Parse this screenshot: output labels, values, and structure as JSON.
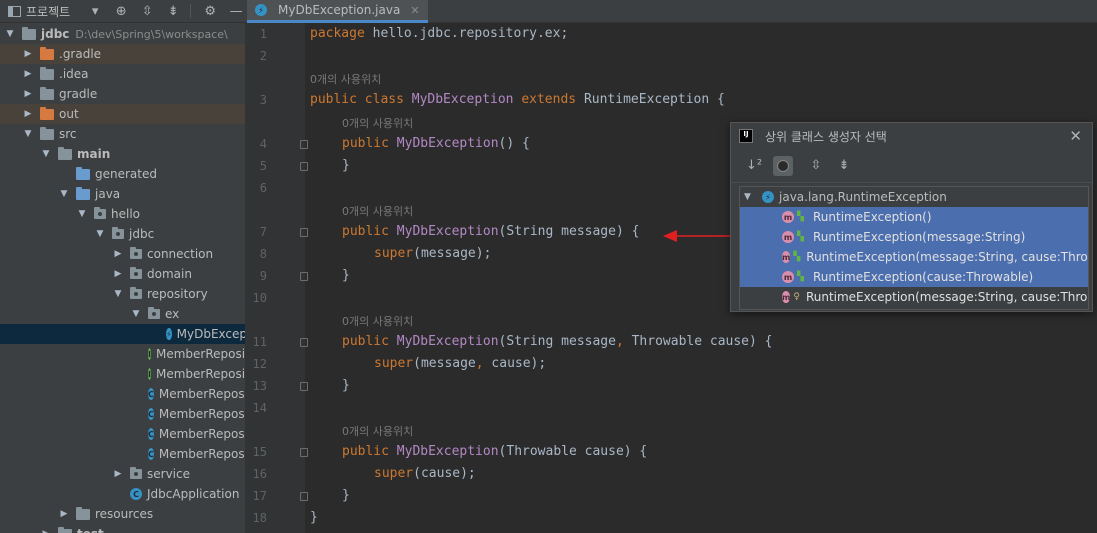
{
  "project_panel": {
    "title": "프로젝트",
    "toolbar_icons": [
      "chevron-down-icon",
      "target-icon",
      "expand-all-icon",
      "collapse-all-icon",
      "gear-icon",
      "minimize-icon"
    ],
    "tree": [
      {
        "label": "jdbc",
        "path": "D:\\dev\\Spring\\5\\workspace\\"
      },
      {
        "label": ".gradle"
      },
      {
        "label": ".idea"
      },
      {
        "label": "gradle"
      },
      {
        "label": "out"
      },
      {
        "label": "src"
      },
      {
        "label": "main"
      },
      {
        "label": "generated"
      },
      {
        "label": "java"
      },
      {
        "label": "hello"
      },
      {
        "label": "jdbc"
      },
      {
        "label": "connection"
      },
      {
        "label": "domain"
      },
      {
        "label": "repository"
      },
      {
        "label": "ex"
      },
      {
        "label": "MyDbExcep"
      },
      {
        "label": "MemberReposi"
      },
      {
        "label": "MemberReposi"
      },
      {
        "label": "MemberReposi"
      },
      {
        "label": "MemberReposi"
      },
      {
        "label": "MemberReposi"
      },
      {
        "label": "MemberReposi"
      },
      {
        "label": "service"
      },
      {
        "label": "JdbcApplication"
      },
      {
        "label": "resources"
      },
      {
        "label": "test"
      }
    ]
  },
  "editor": {
    "tab_label": "MyDbException.java",
    "usage_hint": "0개의 사용위치",
    "line_numbers": [
      "1",
      "2",
      "3",
      "4",
      "5",
      "6",
      "7",
      "8",
      "9",
      "10",
      "11",
      "12",
      "13",
      "14",
      "15",
      "16",
      "17",
      "18"
    ],
    "code": {
      "l1_kw": "package",
      "l1_rest": " hello.jdbc.repository.ex;",
      "l3_kw1": "public class",
      "l3_cls": " MyDbException ",
      "l3_kw2": "extends",
      "l3_rest": " RuntimeException {",
      "l4_kw": "public",
      "l4_fn": " MyDbException",
      "l4_rest": "() {",
      "close_brace": "}",
      "l7_kw": "public",
      "l7_fn": " MyDbException",
      "l7_rest": "(String message) {",
      "l8_kw": "super",
      "l8_rest": "(message);",
      "l11_kw": "public",
      "l11_fn": " MyDbException",
      "l11_a": "(String message",
      "l11_comma": ",",
      "l11_b": " Throwable cause) {",
      "l12_kw": "super",
      "l12_a": "(message",
      "l12_comma": ",",
      "l12_b": " cause);",
      "l15_kw": "public",
      "l15_fn": " MyDbException",
      "l15_rest": "(Throwable cause) {",
      "l16_kw": "super",
      "l16_rest": "(cause);"
    }
  },
  "popup": {
    "title": "상위 클래스 생성자 선택",
    "root": "java.lang.RuntimeException",
    "items": [
      {
        "label": "RuntimeException()",
        "selected": true,
        "access": "public"
      },
      {
        "label": "RuntimeException(message:String)",
        "selected": true,
        "access": "public"
      },
      {
        "label": "RuntimeException(message:String, cause:Throwable",
        "selected": true,
        "access": "public"
      },
      {
        "label": "RuntimeException(cause:Throwable)",
        "selected": true,
        "access": "public"
      },
      {
        "label": "RuntimeException(message:String, cause:Throwabl",
        "selected": false,
        "access": "protected"
      }
    ]
  },
  "colors": {
    "keyword": "#cc7832",
    "method_decl": "#ffc66d",
    "selection": "#4b6eaf",
    "arrow": "#e02020"
  }
}
